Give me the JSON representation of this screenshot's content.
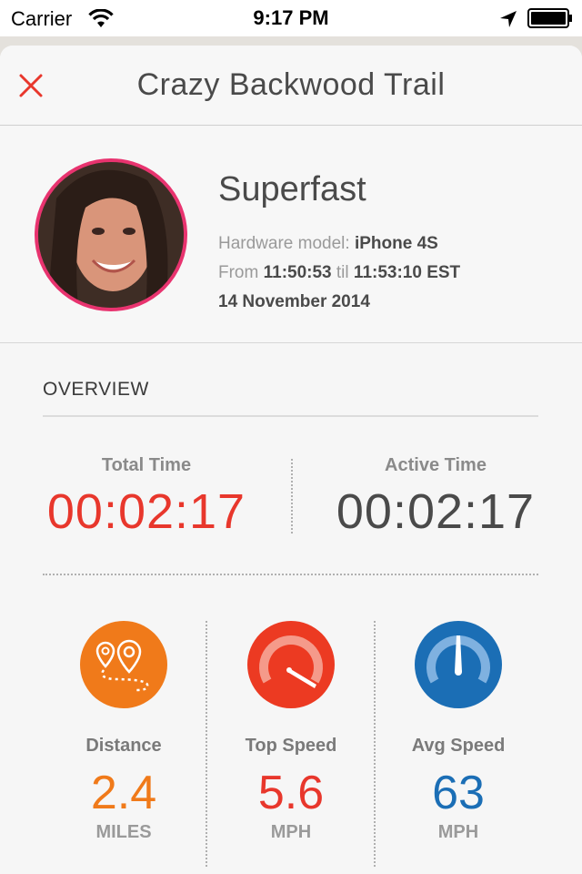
{
  "status_bar": {
    "carrier": "Carrier",
    "time": "9:17 PM"
  },
  "header": {
    "title": "Crazy Backwood Trail"
  },
  "profile": {
    "name": "Superfast",
    "hardware_label": "Hardware model:",
    "hardware_value": "iPhone 4S",
    "from_label": "From",
    "start_time": "11:50:53",
    "til_label": "til",
    "end_time": "11:53:10 EST",
    "date": "14 November 2014"
  },
  "overview": {
    "title": "OVERVIEW",
    "total_time_label": "Total Time",
    "total_time_value": "00:02:17",
    "active_time_label": "Active Time",
    "active_time_value": "00:02:17"
  },
  "stats": [
    {
      "label": "Distance",
      "value": "2.4",
      "unit": "MILES",
      "icon": "map-pins-icon",
      "color": "#f07a1a"
    },
    {
      "label": "Top Speed",
      "value": "5.6",
      "unit": "MPH",
      "icon": "speedometer-icon",
      "color": "#e8372c"
    },
    {
      "label": "Avg Speed",
      "value": "63",
      "unit": "MPH",
      "icon": "gauge-icon",
      "color": "#1b6eb5"
    }
  ],
  "colors": {
    "accent_red": "#e8372c",
    "avatar_border": "#e8336f",
    "distance_orange": "#f07a1a",
    "avg_blue": "#1b6eb5"
  }
}
